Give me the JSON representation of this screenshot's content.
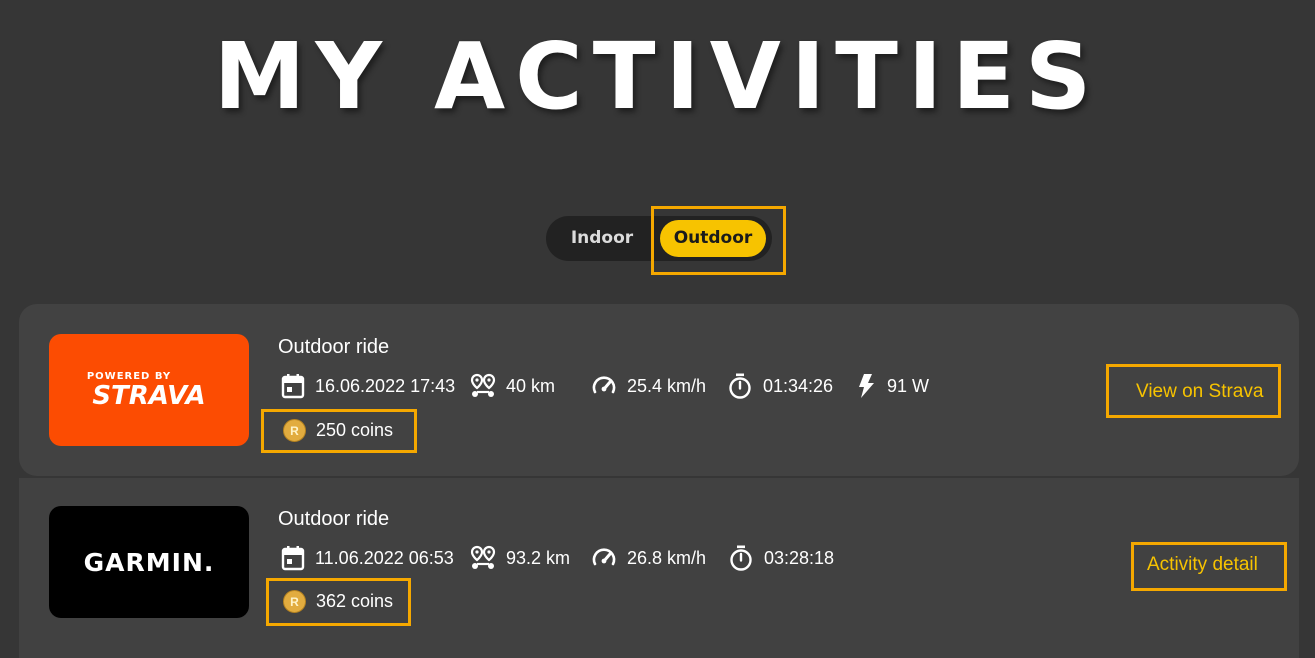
{
  "page": {
    "title": "MY ACTIVITIES"
  },
  "toggle": {
    "indoor_label": "Indoor",
    "outdoor_label": "Outdoor",
    "selected": "Outdoor"
  },
  "colors": {
    "accent": "#f7c300",
    "highlight_border": "#f5a800",
    "background": "#363636",
    "card": "#424242",
    "strava_orange": "#fc4c02",
    "garmin_black": "#000000"
  },
  "activities": [
    {
      "source": "strava",
      "logo": {
        "line1": "POWERED BY",
        "line2": "STRAVA"
      },
      "title": "Outdoor ride",
      "date": "16.06.2022 17:43",
      "distance": "40 km",
      "speed": "25.4 km/h",
      "duration": "01:34:26",
      "power": "91 W",
      "coins": "250 coins",
      "link_label": "View on Strava"
    },
    {
      "source": "garmin",
      "logo": {
        "line1": "GARMIN."
      },
      "title": "Outdoor ride",
      "date": "11.06.2022 06:53",
      "distance": "93.2 km",
      "speed": "26.8 km/h",
      "duration": "03:28:18",
      "coins": "362 coins",
      "link_label": "Activity detail"
    }
  ],
  "icons": {
    "date": "calendar-icon",
    "distance": "route-icon",
    "speed": "speedometer-icon",
    "duration": "stopwatch-icon",
    "power": "lightning-icon",
    "coins": "coin-icon"
  }
}
